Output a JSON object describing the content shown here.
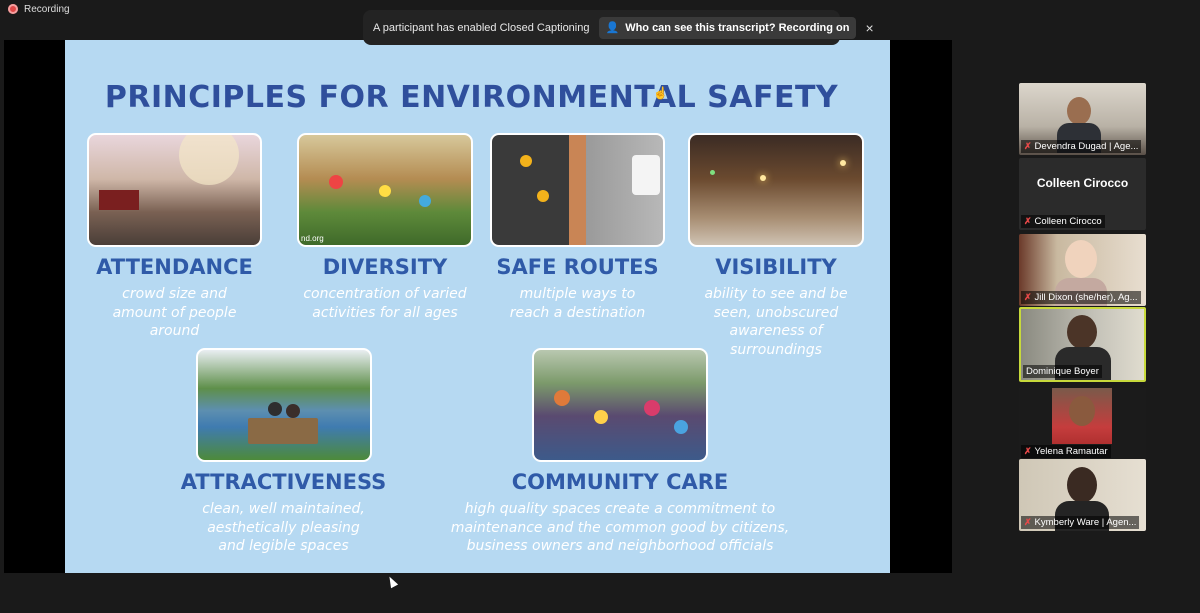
{
  "app": {
    "recording_label": "Recording"
  },
  "caption_banner": {
    "message": "A participant has enabled Closed Captioning",
    "button_label": "Who can see this transcript? Recording on",
    "close_label": "×"
  },
  "slide": {
    "title": "PRINCIPLES FOR ENVIRONMENTAL SAFETY",
    "credit": "nd.org",
    "principles": [
      {
        "heading": "ATTENDANCE",
        "desc": [
          "crowd size and",
          "amount of people",
          "around"
        ]
      },
      {
        "heading": "DIVERSITY",
        "desc": [
          "concentration of varied",
          "activities for all ages"
        ]
      },
      {
        "heading": "SAFE ROUTES",
        "desc": [
          "multiple ways to",
          "reach a destination"
        ]
      },
      {
        "heading": "VISIBILITY",
        "desc": [
          "ability to see and be",
          "seen, unobscured",
          "awareness of",
          "surroundings"
        ]
      },
      {
        "heading": "ATTRACTIVENESS",
        "desc": [
          "clean, well maintained,",
          "aesthetically pleasing",
          "and legible spaces"
        ]
      },
      {
        "heading": "COMMUNITY CARE",
        "desc": [
          "high quality spaces create a commitment to",
          "maintenance and the common good by citizens,",
          "business owners and neighborhood officials"
        ]
      }
    ]
  },
  "participants": [
    {
      "name": "Devendra Dugad | Age...",
      "muted": true,
      "video": true
    },
    {
      "name": "Colleen Cirocco",
      "display_name": "Colleen Cirocco",
      "muted": true,
      "video": false
    },
    {
      "name": "Jill Dixon (she/her), Ag...",
      "muted": true,
      "video": true
    },
    {
      "name": "Dominique Boyer",
      "muted": false,
      "video": true,
      "active_speaker": true
    },
    {
      "name": "Yelena Ramautar",
      "muted": true,
      "video": true
    },
    {
      "name": "Kymberly Ware | Agen...",
      "muted": true,
      "video": true
    }
  ],
  "colors": {
    "slide_bg": "#b6d9f2",
    "title": "#2f4f9c",
    "heading": "#2f5aa8",
    "active_border": "#c7d93b",
    "muted_icon": "#e74848"
  },
  "icons": {
    "recording": "record-dot-icon",
    "muted": "mic-muted-icon",
    "transcript": "transcript-person-icon",
    "close": "close-icon"
  }
}
